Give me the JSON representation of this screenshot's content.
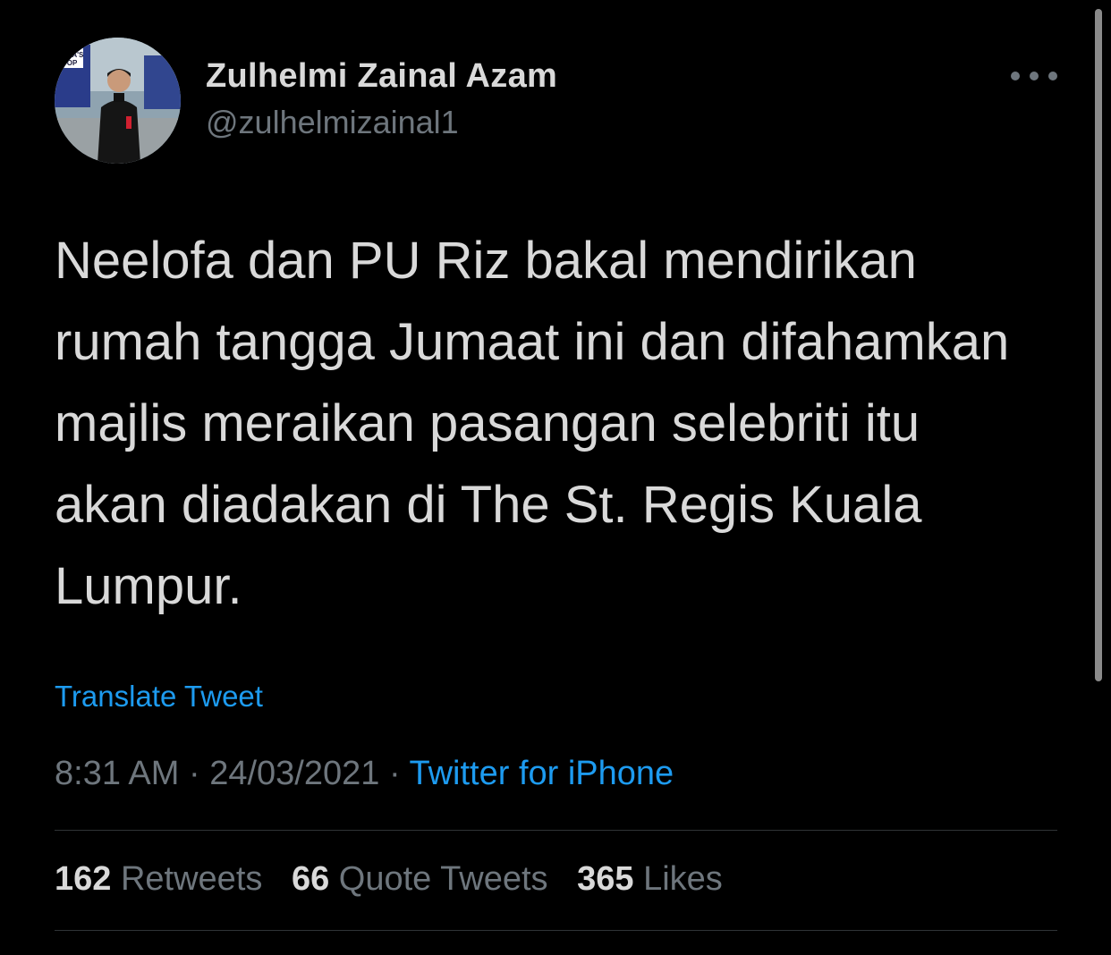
{
  "author": {
    "display_name": "Zulhelmi Zainal Azam",
    "handle": "@zulhelmizainal1",
    "avatar_sign_text": "ASIA'S TOP"
  },
  "tweet": {
    "lines": [
      "Neelofa dan PU Riz bakal mendirikan",
      "rumah tangga Jumaat ini dan difahamkan",
      "majlis meraikan pasangan selebriti itu",
      "akan diadakan di The St. Regis Kuala",
      "Lumpur."
    ],
    "translate_label": "Translate Tweet",
    "time": "8:31 AM",
    "separator": " · ",
    "date": "24/03/2021",
    "source": "Twitter for iPhone"
  },
  "stats": {
    "retweets_count": "162",
    "retweets_label": "Retweets",
    "quotes_count": "66",
    "quotes_label": "Quote Tweets",
    "likes_count": "365",
    "likes_label": "Likes"
  },
  "icons": {
    "more": "more-horizontal-icon"
  },
  "colors": {
    "background": "#000000",
    "text": "#d9d9d9",
    "secondary": "#6e767d",
    "link": "#1d9bf0",
    "divider": "#2f3336"
  }
}
